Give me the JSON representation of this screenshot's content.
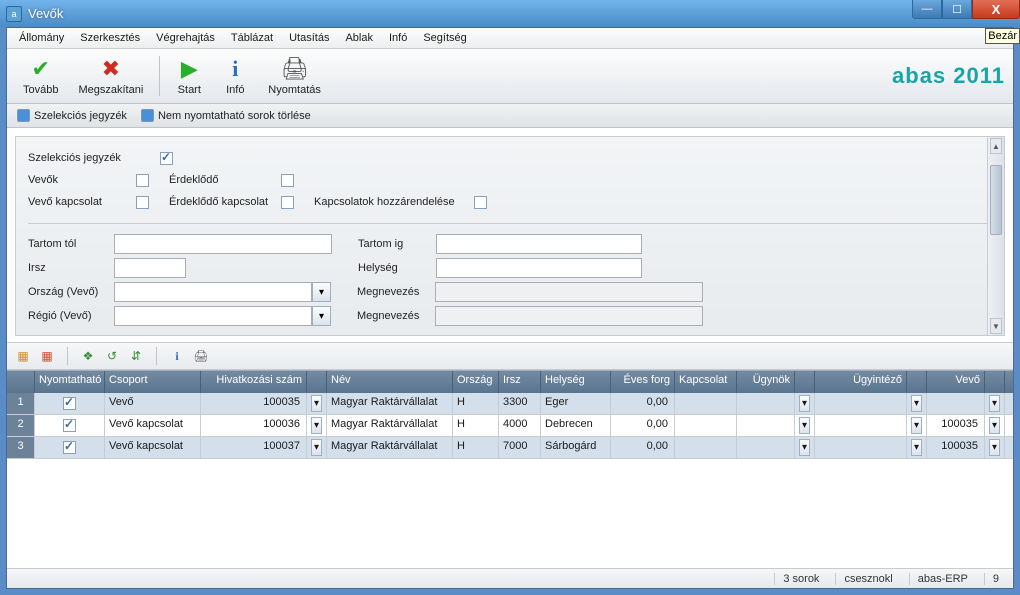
{
  "window": {
    "title": "Vevők"
  },
  "menu": {
    "allomany": "Állomány",
    "szerkesztes": "Szerkesztés",
    "vegrehajtas": "Végrehajtás",
    "tablazat": "Táblázat",
    "utasitas": "Utasítás",
    "ablak": "Ablak",
    "info": "Infó",
    "segitseg": "Segítség",
    "bezar": "Bezár"
  },
  "toolbar": {
    "tovabb": "Tovább",
    "megszak": "Megszakítani",
    "start": "Start",
    "info": "Infó",
    "nyomtatas": "Nyomtatás",
    "brand": "abas 2011"
  },
  "tabs": {
    "szelekcio": "Szelekciós jegyzék",
    "nemnyomt": "Nem nyomtatható sorok törlése"
  },
  "form": {
    "szel_label": "Szelekciós jegyzék",
    "vevok_label": "Vevők",
    "erdek_label": "Érdeklődő",
    "vevokap_label": "Vevő kapcsolat",
    "erdekkap_label": "Érdeklődő kapcsolat",
    "kapcshozz_label": "Kapcsolatok hozzárendelése",
    "tartomtol": "Tartom tól",
    "tartomig": "Tartom ig",
    "irsz": "Irsz",
    "helyseg": "Helység",
    "orszagvevo": "Ország (Vevő)",
    "megnev": "Megnevezés",
    "regiovevo": "Régió (Vevő)"
  },
  "grid": {
    "headers": {
      "nyomtathato": "Nyomtatható",
      "csoport": "Csoport",
      "hiv": "Hivatkozási szám",
      "nev": "Név",
      "orszag": "Ország",
      "irsz": "Irsz",
      "helyseg": "Helység",
      "eves": "Éves forg",
      "kapcsolat": "Kapcsolat",
      "ugynok": "Ügynök",
      "ugyintezo": "Ügyintéző",
      "vevo": "Vevő"
    },
    "rows": [
      {
        "n": "1",
        "print": true,
        "csoport": "Vevő",
        "hiv": "100035",
        "nev": "Magyar Raktárvállalat",
        "orszag": "H",
        "irsz": "3300",
        "helyseg": "Eger",
        "eves": "0,00",
        "vevo": ""
      },
      {
        "n": "2",
        "print": true,
        "csoport": "Vevő kapcsolat",
        "hiv": "100036",
        "nev": "Magyar Raktárvállalat",
        "orszag": "H",
        "irsz": "4000",
        "helyseg": "Debrecen",
        "eves": "0,00",
        "vevo": "100035"
      },
      {
        "n": "3",
        "print": true,
        "csoport": "Vevő kapcsolat",
        "hiv": "100037",
        "nev": "Magyar Raktárvállalat",
        "orszag": "H",
        "irsz": "7000",
        "helyseg": "Sárbogárd",
        "eves": "0,00",
        "vevo": "100035"
      }
    ]
  },
  "status": {
    "sorok": "3 sorok",
    "user": "csesznokl",
    "sys": "abas-ERP",
    "num": "9"
  }
}
